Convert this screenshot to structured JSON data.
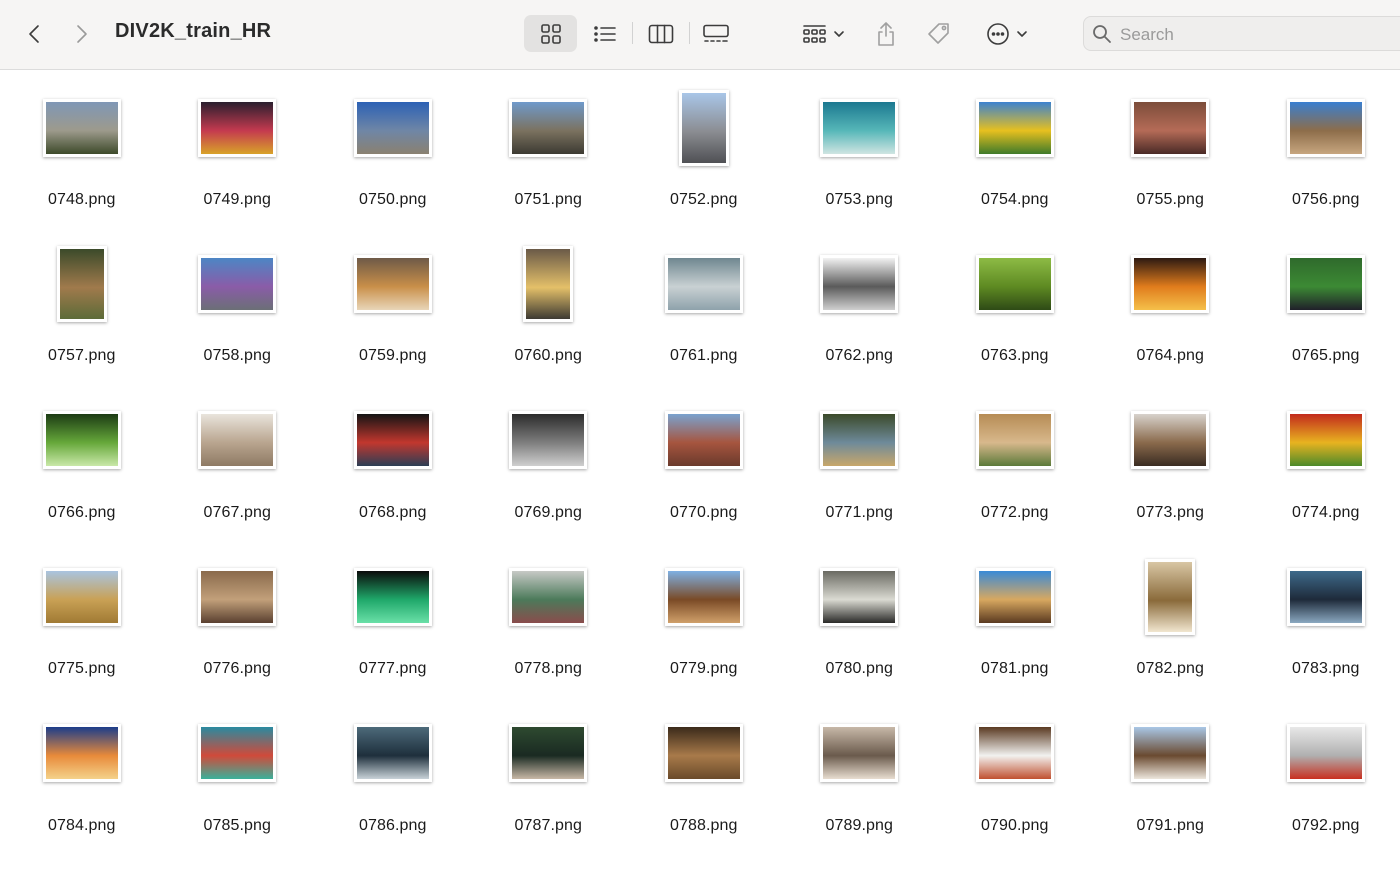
{
  "window": {
    "title": "DIV2K_train_HR"
  },
  "toolbar": {
    "back_icon": "chevron-left-icon",
    "forward_icon": "chevron-right-icon",
    "views": [
      "icon-view",
      "list-view",
      "column-view",
      "gallery-view"
    ],
    "active_view": "icon-view",
    "group_icon": "group-by-icon",
    "share_icon": "share-icon",
    "tag_icon": "tag-icon",
    "action_icon": "more-actions-icon"
  },
  "search": {
    "placeholder": "Search"
  },
  "files": [
    {
      "name": "0748.png",
      "orient": "landscape",
      "colors": [
        "#7f97b6",
        "#9d9a8c",
        "#3d4a2a"
      ]
    },
    {
      "name": "0749.png",
      "orient": "landscape",
      "colors": [
        "#2a1f2e",
        "#c43a4f",
        "#d8a229"
      ]
    },
    {
      "name": "0750.png",
      "orient": "landscape",
      "colors": [
        "#2c61b5",
        "#6f86a6",
        "#8a8170"
      ]
    },
    {
      "name": "0751.png",
      "orient": "landscape",
      "colors": [
        "#6f9acb",
        "#7b7260",
        "#3c3a32"
      ]
    },
    {
      "name": "0752.png",
      "orient": "portrait",
      "colors": [
        "#a9c6e8",
        "#8b8d92",
        "#4f5054"
      ]
    },
    {
      "name": "0753.png",
      "orient": "landscape",
      "colors": [
        "#1c7890",
        "#56b7b8",
        "#cfe5e2"
      ]
    },
    {
      "name": "0754.png",
      "orient": "landscape",
      "colors": [
        "#3c82cf",
        "#e7c01f",
        "#3f7a2a"
      ]
    },
    {
      "name": "0755.png",
      "orient": "landscape",
      "colors": [
        "#7c4d3a",
        "#b56b57",
        "#4a2a26"
      ]
    },
    {
      "name": "0756.png",
      "orient": "landscape",
      "colors": [
        "#3a7fd0",
        "#8d6d4a",
        "#c7a67f"
      ]
    },
    {
      "name": "0757.png",
      "orient": "portrait",
      "colors": [
        "#3b4a2a",
        "#a07a4c",
        "#5c6b38"
      ]
    },
    {
      "name": "0758.png",
      "orient": "landscape",
      "colors": [
        "#4d86c5",
        "#8a5ca8",
        "#6b6f76"
      ]
    },
    {
      "name": "0759.png",
      "orient": "landscape",
      "colors": [
        "#6e5a48",
        "#c98f49",
        "#e8d6b8"
      ]
    },
    {
      "name": "0760.png",
      "orient": "portrait",
      "colors": [
        "#6a5a48",
        "#e4c069",
        "#3d3a33"
      ]
    },
    {
      "name": "0761.png",
      "orient": "landscape",
      "colors": [
        "#6f8790",
        "#c9d1d3",
        "#8ea2ab"
      ]
    },
    {
      "name": "0762.png",
      "orient": "landscape",
      "colors": [
        "#f2f2f2",
        "#5a5a5a",
        "#cfcfcf"
      ]
    },
    {
      "name": "0763.png",
      "orient": "landscape",
      "colors": [
        "#8dbb45",
        "#5e8a22",
        "#2e4a16"
      ]
    },
    {
      "name": "0764.png",
      "orient": "landscape",
      "colors": [
        "#2d1a12",
        "#e07c1c",
        "#f5c04a"
      ]
    },
    {
      "name": "0765.png",
      "orient": "landscape",
      "colors": [
        "#2f6a2c",
        "#3c8a34",
        "#20202a"
      ]
    },
    {
      "name": "0766.png",
      "orient": "landscape",
      "colors": [
        "#1c3b14",
        "#66a83a",
        "#c9e8a8"
      ]
    },
    {
      "name": "0767.png",
      "orient": "landscape",
      "colors": [
        "#e9e4dc",
        "#b9a58f",
        "#8e7a64"
      ]
    },
    {
      "name": "0768.png",
      "orient": "landscape",
      "colors": [
        "#141414",
        "#c2372e",
        "#2c3e55"
      ]
    },
    {
      "name": "0769.png",
      "orient": "landscape",
      "colors": [
        "#2b2b2b",
        "#7e7e7e",
        "#cfcfcf"
      ]
    },
    {
      "name": "0770.png",
      "orient": "landscape",
      "colors": [
        "#7aa2cf",
        "#a6553f",
        "#6a3a2c"
      ]
    },
    {
      "name": "0771.png",
      "orient": "landscape",
      "colors": [
        "#3b4a2a",
        "#6e8a9a",
        "#c8a76a"
      ]
    },
    {
      "name": "0772.png",
      "orient": "landscape",
      "colors": [
        "#b68c55",
        "#d8b88c",
        "#5c7a3a"
      ]
    },
    {
      "name": "0773.png",
      "orient": "landscape",
      "colors": [
        "#d7d2cc",
        "#8a6a4c",
        "#3a2c22"
      ]
    },
    {
      "name": "0774.png",
      "orient": "landscape",
      "colors": [
        "#c22a1c",
        "#e8b320",
        "#4c8a2a"
      ]
    },
    {
      "name": "0775.png",
      "orient": "landscape",
      "colors": [
        "#a9c4e0",
        "#c9a155",
        "#a07a34"
      ]
    },
    {
      "name": "0776.png",
      "orient": "landscape",
      "colors": [
        "#8a6a4c",
        "#c2a07a",
        "#5a4030"
      ]
    },
    {
      "name": "0777.png",
      "orient": "landscape",
      "colors": [
        "#0a0a0a",
        "#1fa86a",
        "#6ae0a8"
      ]
    },
    {
      "name": "0778.png",
      "orient": "landscape",
      "colors": [
        "#c7c9c6",
        "#4c7a5a",
        "#8a4c4c"
      ]
    },
    {
      "name": "0779.png",
      "orient": "landscape",
      "colors": [
        "#7fb0e3",
        "#7a4a26",
        "#d0a06a"
      ]
    },
    {
      "name": "0780.png",
      "orient": "landscape",
      "colors": [
        "#6a6a62",
        "#dadad2",
        "#2a2a28"
      ]
    },
    {
      "name": "0781.png",
      "orient": "landscape",
      "colors": [
        "#3a8ad6",
        "#d8a860",
        "#5a3a20"
      ]
    },
    {
      "name": "0782.png",
      "orient": "portrait",
      "colors": [
        "#d8c6a4",
        "#8a6a3a",
        "#f1e6cf"
      ]
    },
    {
      "name": "0783.png",
      "orient": "landscape",
      "colors": [
        "#3e6a8a",
        "#1e2a3a",
        "#8aa8c0"
      ]
    },
    {
      "name": "0784.png",
      "orient": "landscape",
      "colors": [
        "#1c3d8a",
        "#e88a3a",
        "#f4d28a"
      ]
    },
    {
      "name": "0785.png",
      "orient": "landscape",
      "colors": [
        "#2a8aa0",
        "#d04a3a",
        "#3ab09a"
      ]
    },
    {
      "name": "0786.png",
      "orient": "landscape",
      "colors": [
        "#4d6a7a",
        "#1e2f3c",
        "#c8d2d8"
      ]
    },
    {
      "name": "0787.png",
      "orient": "landscape",
      "colors": [
        "#2e4a30",
        "#1a2a22",
        "#c8b8a6"
      ]
    },
    {
      "name": "0788.png",
      "orient": "landscape",
      "colors": [
        "#3a2a1a",
        "#a87a4a",
        "#6a4a2a"
      ]
    },
    {
      "name": "0789.png",
      "orient": "landscape",
      "colors": [
        "#c7b8a8",
        "#6a5a4c",
        "#e8ddd0"
      ]
    },
    {
      "name": "0790.png",
      "orient": "landscape",
      "colors": [
        "#5a3a22",
        "#f2f2f0",
        "#c05030"
      ]
    },
    {
      "name": "0791.png",
      "orient": "landscape",
      "colors": [
        "#a9c7e6",
        "#6a4a30",
        "#ece6dc"
      ]
    },
    {
      "name": "0792.png",
      "orient": "landscape",
      "colors": [
        "#e8e8e8",
        "#b0b0b0",
        "#c83020"
      ]
    }
  ]
}
